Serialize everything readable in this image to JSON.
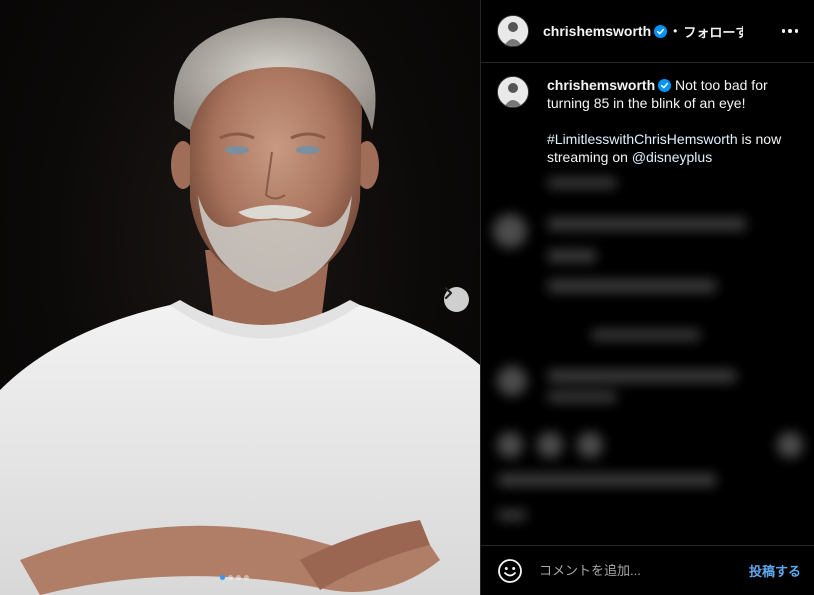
{
  "post": {
    "image_alt": "Portrait of an older man with grey hair and beard wearing a white t-shirt, arms crossed",
    "carousel": {
      "slides": 4,
      "active_index": 0
    }
  },
  "header": {
    "username": "chrishemsworth",
    "separator": "•",
    "follow_label": "フォローする"
  },
  "caption": {
    "username": "chrishemsworth",
    "text_line1": " Not too bad for turning 85 in the blink of an eye!",
    "hashtag": "#LimitlesswithChrisHemsworth",
    "text_line2": " is now streaming on ",
    "mention": "@disneyplus"
  },
  "comment_bar": {
    "placeholder": "コメントを追加...",
    "post_label": "投稿する"
  },
  "colors": {
    "background": "#000000",
    "verified": "#0095f6",
    "link": "#e0f1ff",
    "post_button": "#5fa8ee",
    "dot_active": "#3897f0"
  },
  "icons": [
    "verified-badge-icon",
    "more-options-icon",
    "chevron-right-icon",
    "emoji-icon"
  ]
}
